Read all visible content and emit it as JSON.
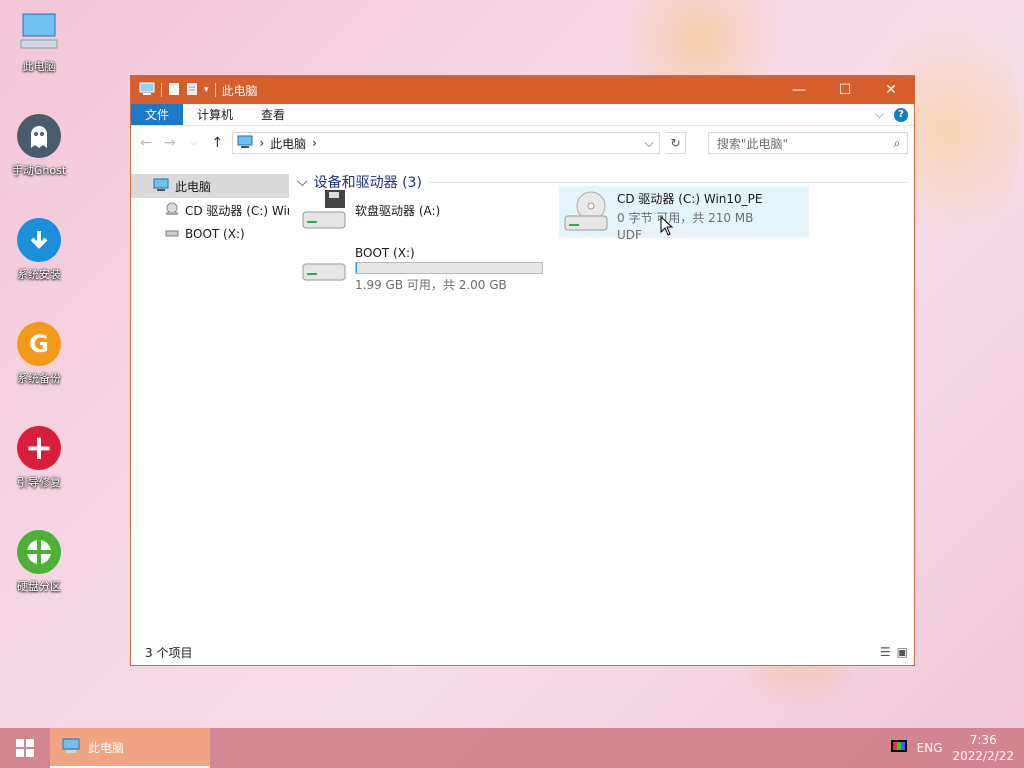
{
  "desktop": {
    "icons": [
      {
        "label": "此电脑",
        "icon": "computer-icon",
        "color": "#3a8fd6"
      },
      {
        "label": "手动Ghost",
        "icon": "ghost-icon",
        "color": "#4a5b6b"
      },
      {
        "label": "系统安装",
        "icon": "install-arrow-icon",
        "color": "#1b8fd9"
      },
      {
        "label": "系统备份",
        "icon": "backup-g-icon",
        "color": "#f39a1c"
      },
      {
        "label": "引导修复",
        "icon": "repair-plus-icon",
        "color": "#d81e3a"
      },
      {
        "label": "硬盘分区",
        "icon": "partition-icon",
        "color": "#4eb035"
      }
    ]
  },
  "window": {
    "title": "此电脑",
    "ribbon_tabs": [
      "文件",
      "计算机",
      "查看"
    ],
    "address": {
      "root": "此电脑"
    },
    "search_placeholder": "搜索\"此电脑\"",
    "nav_pane": [
      {
        "label": "此电脑",
        "icon": "computer-icon",
        "selected": true
      },
      {
        "label": "CD 驱动器 (C:) Wir",
        "icon": "cd-drive-icon",
        "selected": false
      },
      {
        "label": "BOOT (X:)",
        "icon": "drive-icon",
        "selected": false
      }
    ],
    "group": {
      "label": "设备和驱动器 (3)"
    },
    "drives": [
      {
        "name": "软盘驱动器 (A:)",
        "icon": "floppy-drive-icon"
      },
      {
        "name": "CD 驱动器 (C:) Win10_PE",
        "line2": "0 字节 可用，共 210 MB",
        "line3": "UDF",
        "icon": "cd-drive-icon"
      },
      {
        "name": "BOOT (X:)",
        "line2": "1.99 GB 可用，共 2.00 GB",
        "usage_fraction": 0.005,
        "icon": "drive-icon"
      }
    ],
    "status": "3 个项目"
  },
  "taskbar": {
    "app_label": "此电脑",
    "lang": "ENG",
    "time": "7:36",
    "date": "2022/2/22"
  },
  "colors": {
    "titlebar": "#d45e2c",
    "accent": "#1979ca",
    "group_header": "#1e3287"
  }
}
